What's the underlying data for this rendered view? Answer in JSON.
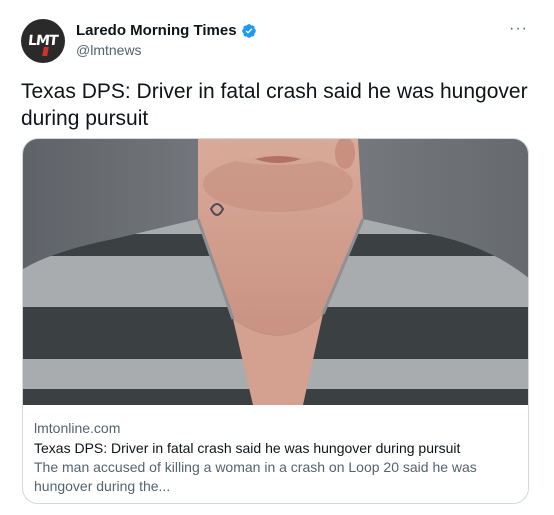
{
  "author": {
    "avatar_text": "LMT",
    "name": "Laredo Morning Times",
    "verified": true,
    "handle": "@lmtnews"
  },
  "more_label": "···",
  "tweet": {
    "text": "Texas DPS: Driver in fatal crash said he was hungover during pursuit"
  },
  "card": {
    "domain": "lmtonline.com",
    "title": "Texas DPS: Driver in fatal crash said he was hungover during pursuit",
    "description": "The man accused of killing a woman in a crash on Loop 20 said he was hungover during the..."
  },
  "colors": {
    "verified_badge": "#1d9bf0",
    "secondary_text": "#536471",
    "primary_text": "#0f1419",
    "card_border": "#cfd9de"
  }
}
